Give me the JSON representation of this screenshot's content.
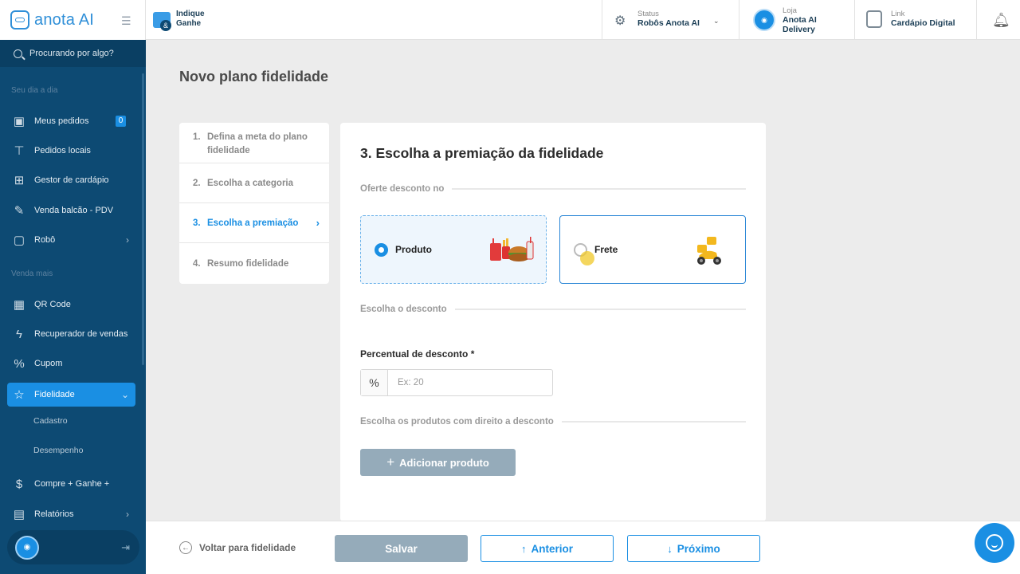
{
  "brand": {
    "logo_text": "anota AI"
  },
  "search": {
    "placeholder": "Procurando por algo?"
  },
  "sidebar": {
    "section_day": "Seu dia a dia",
    "section_sell": "Venda mais",
    "items": [
      {
        "label": "Meus pedidos",
        "icon": "orders-icon",
        "badge": "0"
      },
      {
        "label": "Pedidos locais",
        "icon": "table-icon"
      },
      {
        "label": "Gestor de cardápio",
        "icon": "grid-icon"
      },
      {
        "label": "Venda balcão - PDV",
        "icon": "edit-icon"
      },
      {
        "label": "Robô",
        "icon": "chat-icon"
      },
      {
        "label": "QR Code",
        "icon": "qrcode-icon"
      },
      {
        "label": "Recuperador de vendas",
        "icon": "lightning-icon"
      },
      {
        "label": "Cupom",
        "icon": "percent-icon"
      },
      {
        "label": "Fidelidade",
        "icon": "star-icon"
      },
      {
        "label": "Compre + Ganhe +",
        "icon": "dollar-icon"
      },
      {
        "label": "Relatórios",
        "icon": "report-icon"
      }
    ],
    "sub_items": [
      "Cadastro",
      "Desempenho"
    ]
  },
  "topbar": {
    "referral": "Indique\nGanhe",
    "status_label": "Status",
    "status_value": "Robôs Anota AI",
    "store_label": "Loja",
    "store_value": "Anota AI\nDelivery",
    "link_label": "Link",
    "link_value": "Cardápio Digital"
  },
  "page": {
    "title": "Novo plano fidelidade"
  },
  "steps": [
    {
      "num": "1.",
      "label": "Defina a meta do plano fidelidade"
    },
    {
      "num": "2.",
      "label": "Escolha a categoria"
    },
    {
      "num": "3.",
      "label": "Escolha a premiação"
    },
    {
      "num": "4.",
      "label": "Resumo fidelidade"
    }
  ],
  "form": {
    "title": "3. Escolha a premiação da fidelidade",
    "offer_section": "Oferte desconto no",
    "option_product": "Produto",
    "option_shipping": "Frete",
    "discount_section": "Escolha o desconto",
    "percent_label": "Percentual de desconto *",
    "percent_prefix": "%",
    "percent_placeholder": "Ex: 20",
    "products_section": "Escolha os produtos com direito a desconto",
    "add_product": "Adicionar produto"
  },
  "footer": {
    "back": "Voltar para fidelidade",
    "save": "Salvar",
    "previous": "Anterior",
    "next": "Próximo"
  },
  "colors": {
    "accent": "#1a8fe3",
    "sidebar": "#0d4a73",
    "disabled": "#95abba"
  }
}
